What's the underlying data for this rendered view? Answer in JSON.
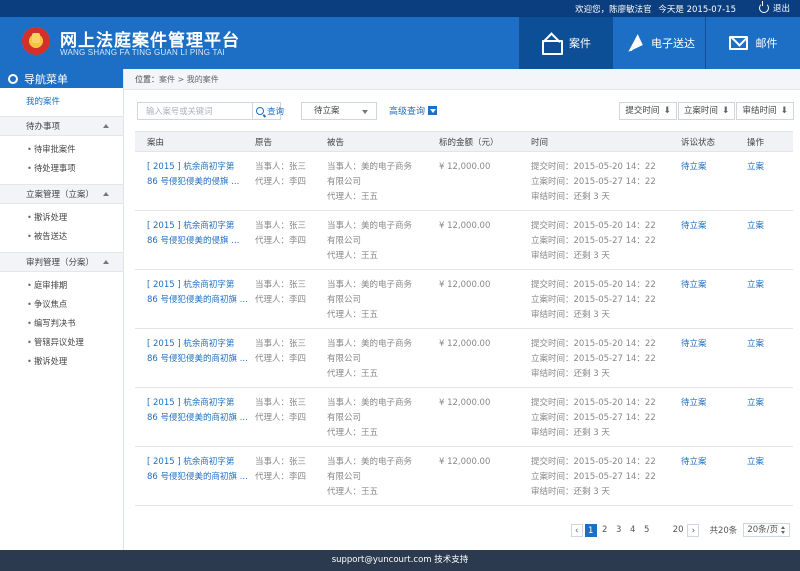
{
  "topbar": {
    "welcome": "欢迎您，陈廖敏法官",
    "today": "今天是 2015-07-15",
    "logout_label": "退出"
  },
  "brand": {
    "title": "网上法庭案件管理平台",
    "subtitle": "WANG SHANG FA TING GUAN LI PING TAI"
  },
  "nav": {
    "items": [
      {
        "label": "案件",
        "icon": "mail-open-icon",
        "active": true
      },
      {
        "label": "电子送达",
        "icon": "paper-plane-icon"
      },
      {
        "label": "邮件",
        "icon": "mail-icon"
      }
    ]
  },
  "sidebar": {
    "header": "导航菜单",
    "top_item": "我的案件",
    "groups": [
      {
        "label": "待办事项",
        "items": [
          "待审批案件",
          "待处理事项"
        ]
      },
      {
        "label": "立案管理（立案）",
        "items": [
          "撤诉处理",
          "被告送达"
        ]
      },
      {
        "label": "审判管理（分案）",
        "items": [
          "庭审排期",
          "争议焦点",
          "编写判决书",
          "管辖异议处理",
          "撤诉处理"
        ]
      }
    ]
  },
  "breadcrumb": {
    "label": "位置：",
    "path": "案件 > 我的案件"
  },
  "search": {
    "placeholder": "输入案号或关键词",
    "button_label": "查询",
    "status_value": "待立案",
    "advanced_label": "高级查询",
    "sort_buttons": [
      "提交时间",
      "立案时间",
      "审结时间"
    ],
    "sort_arrow": "⬇"
  },
  "table": {
    "headers": [
      "案由",
      "原告",
      "被告",
      "标的金额（元）",
      "时间",
      "诉讼状态",
      "操作"
    ],
    "rows": [
      {
        "case_line1": "[ 2015 ] 杭余商初字第",
        "case_line2": "86 号侵犯侵美的侵旗 ...",
        "plaintiff": "当事人：张三",
        "agent": "代理人：李四",
        "def_line1": "当事人：美的电子商务",
        "def_line2": "有限公司",
        "def_agent": "代理人：王五",
        "amount": "¥ 12,000.00",
        "submit": "提交时间：2015-05-20 14：22",
        "filed": "立案时间：2015-05-27 14：22",
        "close": "审结时间：还剩 3 天",
        "status": "待立案",
        "op": "立案"
      },
      {
        "case_line1": "[ 2015 ] 杭余商初字第",
        "case_line2": "86 号侵犯侵美的侵旗 ...",
        "plaintiff": "当事人：张三",
        "agent": "代理人：李四",
        "def_line1": "当事人：美的电子商务",
        "def_line2": "有限公司",
        "def_agent": "代理人：王五",
        "amount": "¥ 12,000.00",
        "submit": "提交时间：2015-05-20 14：22",
        "filed": "立案时间：2015-05-27 14：22",
        "close": "审结时间：还剩 3 天",
        "status": "待立案",
        "op": "立案"
      },
      {
        "case_line1": "[ 2015 ] 杭余商初字第",
        "case_line2": "86 号侵犯侵美的商初旗 ...",
        "plaintiff": "当事人：张三",
        "agent": "代理人：李四",
        "def_line1": "当事人：美的电子商务",
        "def_line2": "有限公司",
        "def_agent": "代理人：王五",
        "amount": "¥ 12,000.00",
        "submit": "提交时间：2015-05-20 14：22",
        "filed": "立案时间：2015-05-27 14：22",
        "close": "审结时间：还剩 3 天",
        "status": "待立案",
        "op": "立案"
      },
      {
        "case_line1": "[ 2015 ] 杭余商初字第",
        "case_line2": "86 号侵犯侵美的商初旗 ...",
        "plaintiff": "当事人：张三",
        "agent": "代理人：李四",
        "def_line1": "当事人：美的电子商务",
        "def_line2": "有限公司",
        "def_agent": "代理人：王五",
        "amount": "¥ 12,000.00",
        "submit": "提交时间：2015-05-20 14：22",
        "filed": "立案时间：2015-05-27 14：22",
        "close": "审结时间：还剩 3 天",
        "status": "待立案",
        "op": "立案"
      },
      {
        "case_line1": "[ 2015 ] 杭余商初字第",
        "case_line2": "86 号侵犯侵美的商初旗 ...",
        "plaintiff": "当事人：张三",
        "agent": "代理人：李四",
        "def_line1": "当事人：美的电子商务",
        "def_line2": "有限公司",
        "def_agent": "代理人：王五",
        "amount": "¥ 12,000.00",
        "submit": "提交时间：2015-05-20 14：22",
        "filed": "立案时间：2015-05-27 14：22",
        "close": "审结时间：还剩 3 天",
        "status": "待立案",
        "op": "立案"
      },
      {
        "case_line1": "[ 2015 ] 杭余商初字第",
        "case_line2": "86 号侵犯侵美的商初旗 ...",
        "plaintiff": "当事人：张三",
        "agent": "代理人：李四",
        "def_line1": "当事人：美的电子商务",
        "def_line2": "有限公司",
        "def_agent": "代理人：王五",
        "amount": "¥ 12,000.00",
        "submit": "提交时间：2015-05-20 14：22",
        "filed": "立案时间：2015-05-27 14：22",
        "close": "审结时间：还剩 3 天",
        "status": "待立案",
        "op": "立案"
      }
    ]
  },
  "pager": {
    "prev": "‹",
    "pages": [
      "1",
      "2",
      "3",
      "4",
      "5"
    ],
    "current": "1",
    "last": "20",
    "next": "›",
    "total": "共20条",
    "per_page": "20条/页"
  },
  "footer": {
    "text": "support@yuncourt.com 技术支持"
  },
  "colors": {
    "primary": "#1c6fc4",
    "topbar": "#0b3e7e",
    "footer": "#2b3a4e"
  }
}
